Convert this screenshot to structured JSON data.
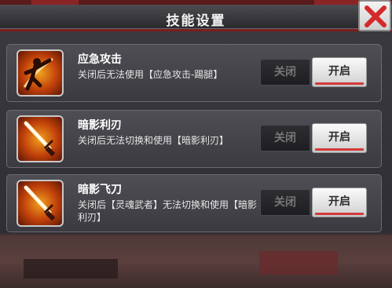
{
  "dialog": {
    "title": "技能设置"
  },
  "skills": [
    {
      "name": "应急攻击",
      "description": "关闭后无法使用【应急攻击-踢腿】",
      "off_label": "关闭",
      "on_label": "开启",
      "enabled": true,
      "icon": "kick-fighter-icon"
    },
    {
      "name": "暗影利刃",
      "description": "关闭后无法切换和使用【暗影利刃】",
      "off_label": "关闭",
      "on_label": "开启",
      "enabled": true,
      "icon": "blade-icon"
    },
    {
      "name": "暗影飞刀",
      "description": "关闭后【灵魂武者】无法切换和使用【暗影利刃】",
      "off_label": "关闭",
      "on_label": "开启",
      "enabled": true,
      "icon": "blade-icon"
    }
  ],
  "colors": {
    "accent_red": "#d23a3a",
    "icon_orange": "#f0a020"
  }
}
